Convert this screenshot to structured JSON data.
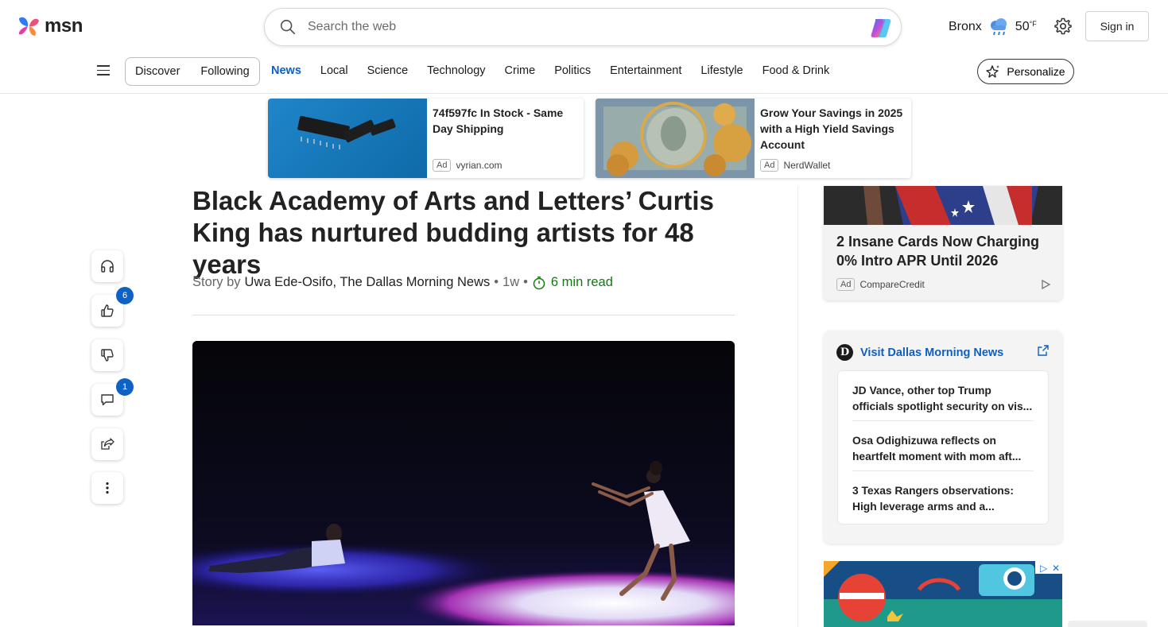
{
  "header": {
    "logo_text": "msn",
    "search_placeholder": "Search the web",
    "location": "Bronx",
    "temperature": "50",
    "temperature_unit": "°F",
    "signin_label": "Sign in"
  },
  "nav": {
    "feed_tabs": [
      "Discover",
      "Following"
    ],
    "links": [
      "News",
      "Local",
      "Science",
      "Technology",
      "Crime",
      "Politics",
      "Entertainment",
      "Lifestyle",
      "Food & Drink"
    ],
    "active_link": "News",
    "personalize_label": "Personalize"
  },
  "top_ads": [
    {
      "title": "74f597fc In Stock - Same Day Shipping",
      "badge": "Ad",
      "source": "vyrian.com"
    },
    {
      "title": "Grow Your Savings in 2025 with a High Yield Savings Account",
      "badge": "Ad",
      "source": "NerdWallet"
    }
  ],
  "article": {
    "headline": "Black Academy of Arts and Letters’ Curtis King has nurtured budding artists for 48 years",
    "story_by": "Story by",
    "author": "Uwa Ede-Osifo, The Dallas Morning News",
    "age": "1w",
    "read_time": "6 min read"
  },
  "actions": {
    "like_count": "6",
    "comment_count": "1"
  },
  "side_ad": {
    "title": "2 Insane Cards Now Charging 0% Intro APR Until 2026",
    "badge": "Ad",
    "source": "CompareCredit"
  },
  "publisher": {
    "logo_letter": "D",
    "visit_label": "Visit Dallas Morning News",
    "items": [
      "JD Vance, other top Trump officials spotlight security on vis...",
      "Osa Odighizuwa reflects on heartfelt moment with mom aft...",
      "3 Texas Rangers observations: High leverage arms and a..."
    ]
  },
  "colors": {
    "accent": "#0f5fbf",
    "read_time": "#107c10",
    "badge_blue": "#0f62c5"
  }
}
